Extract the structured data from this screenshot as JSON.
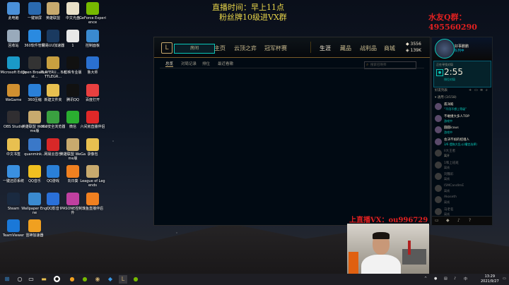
{
  "overlay": {
    "line1": "直播时间：早上11点",
    "line2": "粉丝牌10级进VX群",
    "qq": "水友Q群：495560290",
    "vx": "上直播VX：ou996729"
  },
  "desktop": {
    "icons": [
      {
        "label": "此电脑",
        "color": "#4a90d9"
      },
      {
        "label": "一键锁屏",
        "color": "#2a6ab0"
      },
      {
        "label": "英雄联盟",
        "color": "#c8aa6e"
      },
      {
        "label": "中文光盘",
        "color": "#e8e0c8"
      },
      {
        "label": "GeForce Experience",
        "color": "#76b900"
      },
      {
        "label": "回收站",
        "color": "#9ab"
      },
      {
        "label": "360软件管家",
        "color": "#2a8ae0"
      },
      {
        "label": "网易UU加速器",
        "color": "#1a3a60"
      },
      {
        "label": "1",
        "color": "#e8e8e8"
      },
      {
        "label": "控制面板",
        "color": "#3a8ad0"
      },
      {
        "label": "Microsoft Edge",
        "color": "#1a9ac8"
      },
      {
        "label": "Open Broadcast...",
        "color": "#333"
      },
      {
        "label": "PLAYERU... BATTLEGR...",
        "color": "#c8a040"
      },
      {
        "label": "剪映专业版",
        "color": "#111"
      },
      {
        "label": "鲁大师",
        "color": "#2a70d0"
      },
      {
        "label": "WeGame",
        "color": "#d09030"
      },
      {
        "label": "360压缩",
        "color": "#2a80d8"
      },
      {
        "label": "新建文件夹",
        "color": "#e8c050"
      },
      {
        "label": "腾讯QQ",
        "color": "#111"
      },
      {
        "label": "百度打开",
        "color": "#e84040"
      },
      {
        "label": "OBS Studio",
        "color": "#302e31"
      },
      {
        "label": "英雄联盟 WeGame版",
        "color": "#c8aa6e"
      },
      {
        "label": "360安全浏览器",
        "color": "#3aa040"
      },
      {
        "label": "微信",
        "color": "#2aae30"
      },
      {
        "label": "六间房直播伴侣",
        "color": "#e02828"
      },
      {
        "label": "中文书签",
        "color": "#e8c050"
      },
      {
        "label": "quanmink...",
        "color": "#3a78c8"
      },
      {
        "label": "网易云音乐",
        "color": "#d82828"
      },
      {
        "label": "英雄联盟 WeGame版",
        "color": "#c8aa6e"
      },
      {
        "label": "录像包",
        "color": "#e8c050"
      },
      {
        "label": "一键还原系统",
        "color": "#3a90e0"
      },
      {
        "label": "QQ音乐",
        "color": "#f0c020"
      },
      {
        "label": "QQ游戏",
        "color": "#2a80d8"
      },
      {
        "label": "向日葵",
        "color": "#f08020"
      },
      {
        "label": "League of Legends",
        "color": "#c8aa6e"
      },
      {
        "label": "Steam",
        "color": "#1a2a40"
      },
      {
        "label": "Wallpaper Engine",
        "color": "#3a8ad0"
      },
      {
        "label": "QQ影音",
        "color": "#2a70d8"
      },
      {
        "label": "IPASONE控制软件",
        "color": "#c040a0"
      },
      {
        "label": "斗鱼直播伴侣",
        "color": "#f08020"
      },
      {
        "label": "TeamViewer",
        "color": "#1a78d8"
      },
      {
        "label": "雷神加速器",
        "color": "#f0a020"
      }
    ]
  },
  "client": {
    "play_label": "房间",
    "nav": [
      "主页",
      "云顶之弈",
      "冠军杯赛",
      "生涯",
      "藏品",
      "战利品",
      "商城"
    ],
    "active_nav": "生涯",
    "currency": {
      "be": "3556",
      "rp": "139K"
    },
    "subtabs": [
      "总览",
      "对局记录",
      "排位",
      "最近看辙"
    ],
    "search_placeholder": "搜索召唤师"
  },
  "panel": {
    "name": "好事鹏鹏",
    "status": "队列中",
    "game_title": "正在寻找对局",
    "clock": "2:55",
    "game_status": "排位对局",
    "friends_title": "好友列表",
    "group": "▾ 通用 (3/158)",
    "friends": [
      {
        "name": "孤洋殿",
        "status": "“不用不想上等级”",
        "color": "#0ac8b9",
        "online": true
      },
      {
        "name": "不敢撞大多人TOP",
        "status": "游戏中",
        "color": "#0ac8b9",
        "online": true
      },
      {
        "name": "圆圆icous",
        "status": "游戏中",
        "color": "#0ac8b9",
        "online": true
      },
      {
        "name": "会决不如的招魂人",
        "status": "3/6 摆拖大乱斗(槽宫选择)",
        "color": "#0ac8b9",
        "online": true
      },
      {
        "name": "II大王者",
        "status": "离开",
        "color": "#a09b8c",
        "online": false
      },
      {
        "name": "1和上班班",
        "status": "离线",
        "color": "#6a6a6a",
        "online": false
      },
      {
        "name": "刘魏彩",
        "status": "离线",
        "color": "#6a6a6a",
        "online": false
      },
      {
        "name": "I5MCandlmE",
        "status": "离线",
        "color": "#6a6a6a",
        "online": false
      },
      {
        "name": "Akoseth",
        "status": "离线",
        "color": "#6a6a6a",
        "online": false
      },
      {
        "name": "马老名",
        "status": "离线",
        "color": "#6a6a6a",
        "online": false
      }
    ]
  },
  "taskbar": {
    "time": "13:29",
    "date": "2021/9/27"
  }
}
